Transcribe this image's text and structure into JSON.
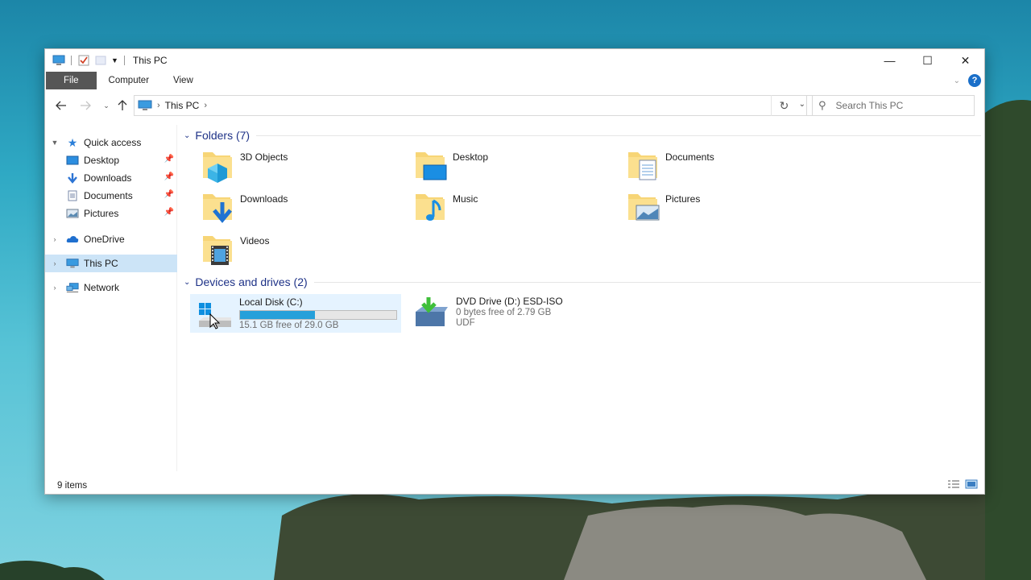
{
  "window": {
    "title": "This PC",
    "controls": {
      "minimize": "—",
      "maximize": "☐",
      "close": "✕"
    }
  },
  "ribbon": {
    "tabs": [
      "File",
      "Computer",
      "View"
    ],
    "help": "?"
  },
  "address": {
    "location": "This PC",
    "search_placeholder": "Search This PC"
  },
  "nav": {
    "quick_access": "Quick access",
    "quick_items": [
      "Desktop",
      "Downloads",
      "Documents",
      "Pictures"
    ],
    "onedrive": "OneDrive",
    "this_pc": "This PC",
    "network": "Network"
  },
  "folders": {
    "header": "Folders (7)",
    "items": [
      "3D Objects",
      "Desktop",
      "Documents",
      "Downloads",
      "Music",
      "Pictures",
      "Videos"
    ]
  },
  "drives": {
    "header": "Devices and drives (2)",
    "items": [
      {
        "name": "Local Disk (C:)",
        "free_text": "15.1 GB free of 29.0 GB",
        "used_fraction": 0.48
      },
      {
        "name": "DVD Drive (D:) ESD-ISO",
        "free_text": "0 bytes free of 2.79 GB",
        "fs": "UDF"
      }
    ]
  },
  "status": {
    "items_count": "9 items"
  },
  "colors": {
    "accent": "#26a0da",
    "selection": "#cce4f7",
    "group_header": "#1e3287",
    "file_tab": "#565656"
  }
}
